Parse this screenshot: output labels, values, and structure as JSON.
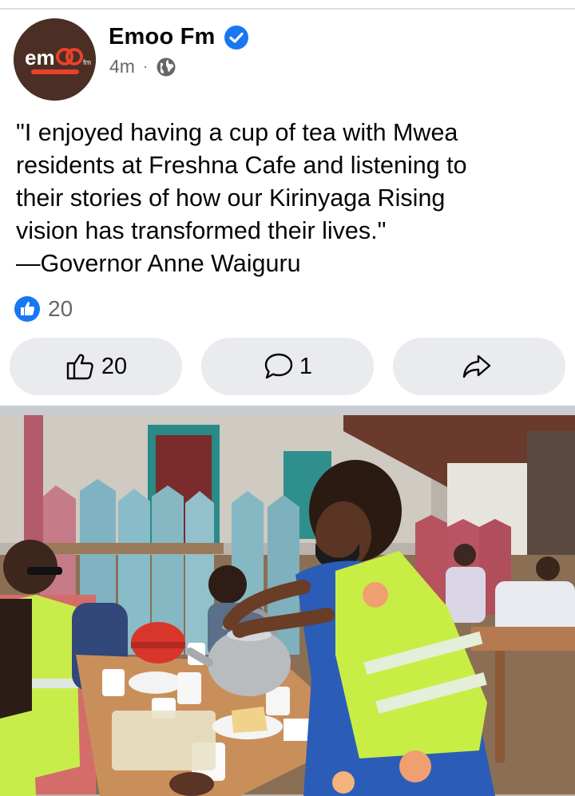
{
  "post": {
    "page_name": "Emoo Fm",
    "timestamp": "4m",
    "separator": "·",
    "text_lines": [
      "\"I enjoyed having a cup of tea with Mwea",
      "residents at Freshna Cafe and listening to",
      "their stories of how our Kirinyaga Rising",
      "vision has transformed their lives.\"",
      "—Governor Anne Waiguru"
    ],
    "reaction_count": "20"
  },
  "avatar": {
    "logo_text": "em",
    "logo_sub": "fm"
  },
  "actions": {
    "like_count": "20",
    "comment_count": "1"
  },
  "icons": {
    "verified": "verified-badge-icon",
    "privacy": "globe-icon",
    "reaction": "like-reaction-icon",
    "like": "thumbs-up-icon",
    "comment": "comment-bubble-icon",
    "share": "share-arrow-icon"
  },
  "colors": {
    "brand_blue": "#1877f2",
    "muted_text": "#65676b",
    "button_bg": "#e9ebee"
  }
}
